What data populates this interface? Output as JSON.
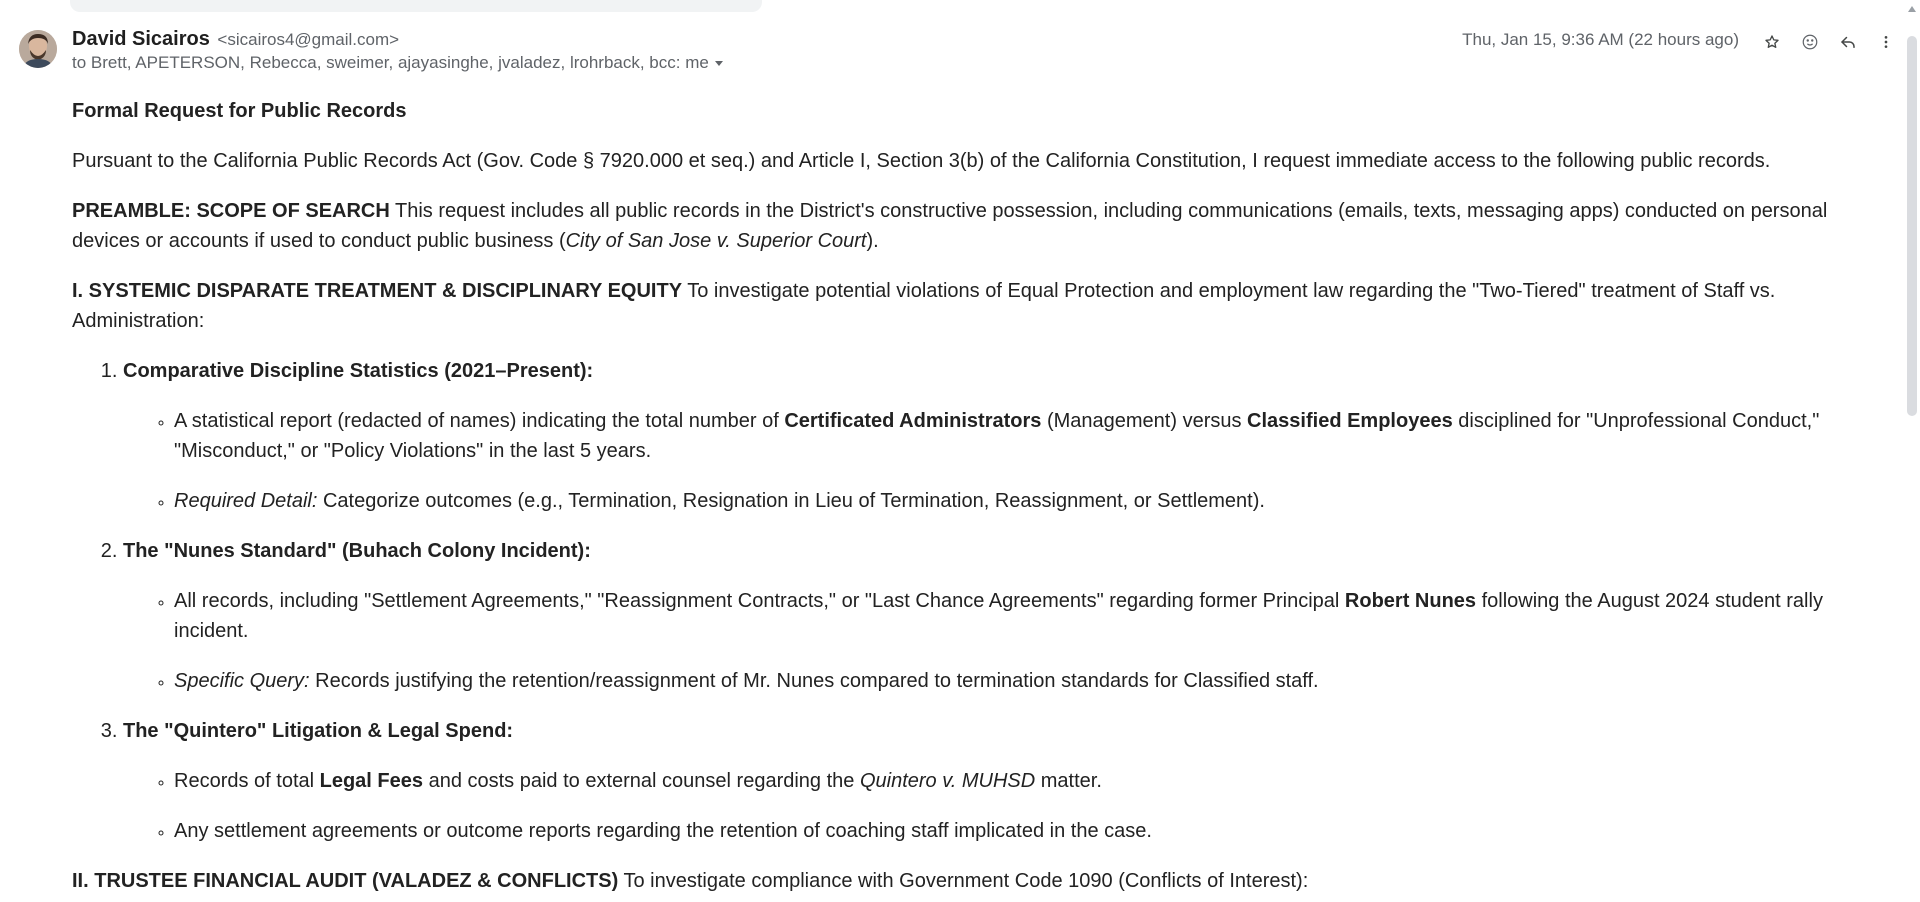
{
  "sender": {
    "name": "David Sicairos",
    "email": "<sicairos4@gmail.com>",
    "recipients": "to Brett, APETERSON, Rebecca, sweimer, ajayasinghe, jvaladez, lrohrback, bcc: me"
  },
  "timestamp": "Thu, Jan 15, 9:36 AM (22 hours ago)",
  "icons": {
    "avatar": "avatar-photo",
    "star": "star-icon",
    "emoji": "emoji-reaction-icon",
    "reply": "reply-icon",
    "more": "more-vert-icon",
    "caret": "chevron-down-icon"
  },
  "email": {
    "subject": "Formal Request for Public Records",
    "intro": "Pursuant to the California Public Records Act (Gov. Code § 7920.000 et seq.) and Article I, Section 3(b) of the California Constitution, I request immediate access to the following public records.",
    "preamble": {
      "heading": "PREAMBLE: SCOPE OF SEARCH",
      "text": " This request includes all public records in the District's constructive possession, including communications (emails, texts, messaging apps) conducted on personal devices or accounts if used to conduct public business (",
      "case": "City of San Jose v. Superior Court",
      "end": ")."
    },
    "section1": {
      "heading": "I. SYSTEMIC DISPARATE TREATMENT & DISCIPLINARY EQUITY",
      "text": " To investigate potential violations of Equal Protection and employment law regarding the \"Two-Tiered\" treatment of Staff vs. Administration:",
      "items": [
        {
          "title": "Comparative Discipline Statistics (2021–Present):",
          "bullets": [
            {
              "a": "A statistical report (redacted of names) indicating the total number of ",
              "b1": "Certificated Administrators",
              "c": " (Management) versus ",
              "b2": "Classified Employees",
              "d": " disciplined for \"Unprofessional Conduct,\" \"Misconduct,\" or \"Policy Violations\" in the last 5 years."
            },
            {
              "label": "Required Detail:",
              "text": " Categorize outcomes (e.g., Termination, Resignation in Lieu of Termination, Reassignment, or Settlement)."
            }
          ]
        },
        {
          "title": "The \"Nunes Standard\" (Buhach Colony Incident):",
          "bullets": [
            {
              "a": "All records, including \"Settlement Agreements,\" \"Reassignment Contracts,\" or \"Last Chance Agreements\" regarding former Principal ",
              "b1": "Robert Nunes",
              "c": " following the August 2024 student rally incident."
            },
            {
              "label": "Specific Query:",
              "text": " Records justifying the retention/reassignment of Mr. Nunes compared to termination standards for Classified staff."
            }
          ]
        },
        {
          "title": "The \"Quintero\" Litigation & Legal Spend:",
          "bullets": [
            {
              "a": "Records of total ",
              "b1": "Legal Fees",
              "c": " and costs paid to external counsel regarding the ",
              "i1": "Quintero v. MUHSD",
              "d": " matter."
            },
            {
              "text": "Any settlement agreements or outcome reports regarding the retention of coaching staff implicated in the case."
            }
          ]
        }
      ]
    },
    "section2": {
      "heading": "II. TRUSTEE FINANCIAL AUDIT (VALADEZ & CONFLICTS)",
      "text": " To investigate compliance with Government Code 1090 (Conflicts of Interest):"
    }
  }
}
